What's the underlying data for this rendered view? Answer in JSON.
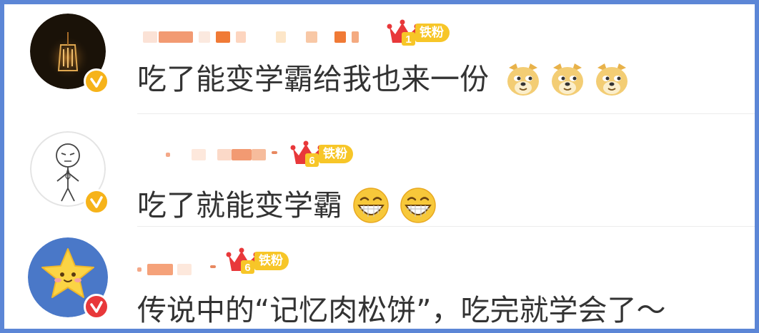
{
  "comments": [
    {
      "text": "吃了能变学霸给我也来一份",
      "fan_label": "铁粉",
      "fan_level": "1",
      "emojis": [
        "doge-emoji",
        "doge-emoji",
        "doge-emoji"
      ]
    },
    {
      "text": "吃了就能变学霸",
      "fan_label": "铁粉",
      "fan_level": "6",
      "emojis": [
        "grin-emoji",
        "grin-emoji"
      ]
    },
    {
      "text": "传说中的“记忆肉松饼”，吃完就学会了～",
      "fan_label": "铁粉",
      "fan_level": "6",
      "emojis": []
    }
  ],
  "colors": {
    "frame_border": "#5c86d6",
    "badge_gold": "#f7c628",
    "crown_red": "#e8383a",
    "verified_gold": "#f6b31a",
    "verified_red": "#e8383a",
    "text": "#333333"
  }
}
